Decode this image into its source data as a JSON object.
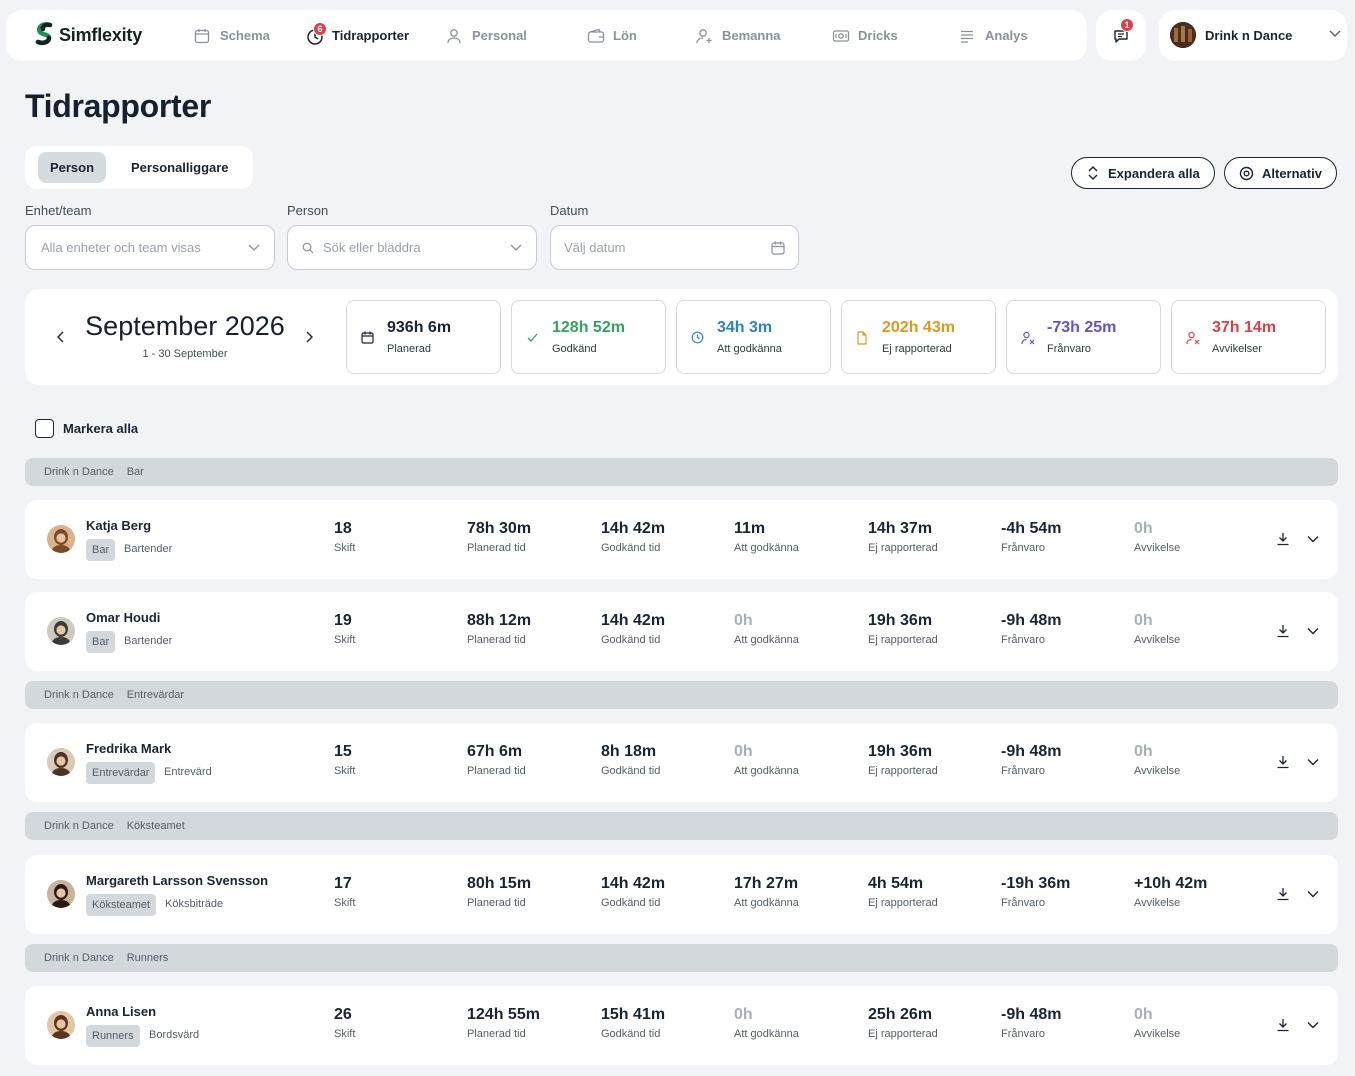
{
  "app": {
    "brand": "Simflexity",
    "nav": [
      {
        "id": "schema",
        "label": "Schema",
        "icon": "calendar-icon"
      },
      {
        "id": "tidrapporter",
        "label": "Tidrapporter",
        "icon": "clock-icon",
        "badge": "6"
      },
      {
        "id": "personal",
        "label": "Personal",
        "icon": "user-icon"
      },
      {
        "id": "lon",
        "label": "Lön",
        "icon": "wallet-icon"
      },
      {
        "id": "bemanna",
        "label": "Bemanna",
        "icon": "user-plus-icon"
      },
      {
        "id": "dricks",
        "label": "Dricks",
        "icon": "cash-icon"
      },
      {
        "id": "analys",
        "label": "Analys",
        "icon": "list-icon"
      }
    ],
    "messages_badge": "1",
    "company": "Drink n Dance"
  },
  "page": {
    "title": "Tidrapporter",
    "tabs": [
      "Person",
      "Personalliggare"
    ],
    "active_tab": "Person",
    "expand_all": "Expandera alla",
    "options": "Alternativ"
  },
  "filters": {
    "unit_label": "Enhet/team",
    "unit_placeholder": "Alla enheter och team visas",
    "person_label": "Person",
    "person_placeholder": "Sök eller bläddra",
    "date_label": "Datum",
    "date_placeholder": "Välj datum"
  },
  "summary": {
    "month": "September 2026",
    "range": "1 - 30 September",
    "stats": [
      {
        "value": "936h 6m",
        "label": "Planerad",
        "color": "#1b2433",
        "icon": "calendar-icon"
      },
      {
        "value": "128h 52m",
        "label": "Godkänd",
        "color": "#2ea55b",
        "icon": "check-icon"
      },
      {
        "value": "34h 3m",
        "label": "Att godkänna",
        "color": "#2c82c9",
        "icon": "clock-icon"
      },
      {
        "value": "202h 43m",
        "label": "Ej rapporterad",
        "color": "#d99b1c",
        "icon": "file-icon"
      },
      {
        "value": "-73h 25m",
        "label": "Frånvaro",
        "color": "#6b4fc6",
        "icon": "user-x-icon"
      },
      {
        "value": "37h 14m",
        "label": "Avvikelser",
        "color": "#d94246",
        "icon": "user-x-icon"
      }
    ]
  },
  "select_all": "Markera alla",
  "metric_labels": [
    "Skift",
    "Planerad tid",
    "Godkänd tid",
    "Att godkänna",
    "Ej rapporterad",
    "Frånvaro",
    "Avvikelse"
  ],
  "groups": [
    {
      "company": "Drink n Dance",
      "team": "Bar",
      "people": [
        {
          "name": "Katja Berg",
          "tag": "Bar",
          "role": "Bartender",
          "values": [
            "18",
            "78h 30m",
            "14h 42m",
            "11m",
            "14h 37m",
            "-4h 54m",
            "0h"
          ]
        },
        {
          "name": "Omar Houdi",
          "tag": "Bar",
          "role": "Bartender",
          "values": [
            "19",
            "88h 12m",
            "14h 42m",
            "0h",
            "19h 36m",
            "-9h 48m",
            "0h"
          ]
        }
      ]
    },
    {
      "company": "Drink n Dance",
      "team": "Entrevärdar",
      "people": [
        {
          "name": "Fredrika Mark",
          "tag": "Entrevärdar",
          "role": "Entrevärd",
          "values": [
            "15",
            "67h 6m",
            "8h 18m",
            "0h",
            "19h 36m",
            "-9h 48m",
            "0h"
          ]
        }
      ]
    },
    {
      "company": "Drink n Dance",
      "team": "Köksteamet",
      "people": [
        {
          "name": "Margareth Larsson Svensson",
          "tag": "Köksteamet",
          "role": "Köksbiträde",
          "values": [
            "17",
            "80h 15m",
            "14h 42m",
            "17h 27m",
            "4h 54m",
            "-19h 36m",
            "+10h 42m"
          ]
        }
      ]
    },
    {
      "company": "Drink n Dance",
      "team": "Runners",
      "people": [
        {
          "name": "Anna Lisen",
          "tag": "Runners",
          "role": "Bordsvärd",
          "values": [
            "26",
            "124h 55m",
            "15h 41m",
            "0h",
            "25h 26m",
            "-9h 48m",
            "0h"
          ]
        }
      ]
    }
  ]
}
